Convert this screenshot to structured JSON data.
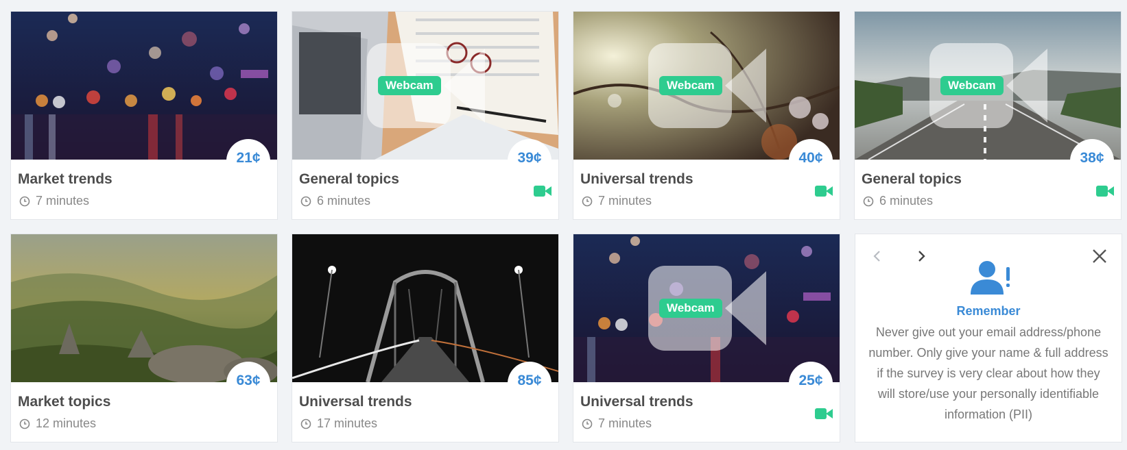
{
  "cards": [
    {
      "title": "Market trends",
      "duration": "7 minutes",
      "price": "21¢",
      "webcam": false,
      "webcam_label": ""
    },
    {
      "title": "General topics",
      "duration": "6 minutes",
      "price": "39¢",
      "webcam": true,
      "webcam_label": "Webcam"
    },
    {
      "title": "Universal trends",
      "duration": "7 minutes",
      "price": "40¢",
      "webcam": true,
      "webcam_label": "Webcam"
    },
    {
      "title": "General topics",
      "duration": "6 minutes",
      "price": "38¢",
      "webcam": true,
      "webcam_label": "Webcam"
    },
    {
      "title": "Market topics",
      "duration": "12 minutes",
      "price": "63¢",
      "webcam": false,
      "webcam_label": ""
    },
    {
      "title": "Universal trends",
      "duration": "17 minutes",
      "price": "85¢",
      "webcam": false,
      "webcam_label": ""
    },
    {
      "title": "Universal trends",
      "duration": "7 minutes",
      "price": "25¢",
      "webcam": true,
      "webcam_label": "Webcam"
    }
  ],
  "reminder": {
    "title": "Remember",
    "text": "Never give out your email address/phone number. Only give your name & full address if the survey is very clear about how they will store/use your personally identifiable information (PII)"
  },
  "colors": {
    "accent": "#3a8ad6",
    "webcam_green": "#2ecc8f",
    "title_text": "#4d4d4d",
    "muted_text": "#888888"
  },
  "icons": {
    "clock": "clock-icon",
    "video": "video-camera-icon",
    "prev": "chevron-left-icon",
    "next": "chevron-right-icon",
    "close": "close-icon",
    "person_alert": "person-alert-icon"
  }
}
